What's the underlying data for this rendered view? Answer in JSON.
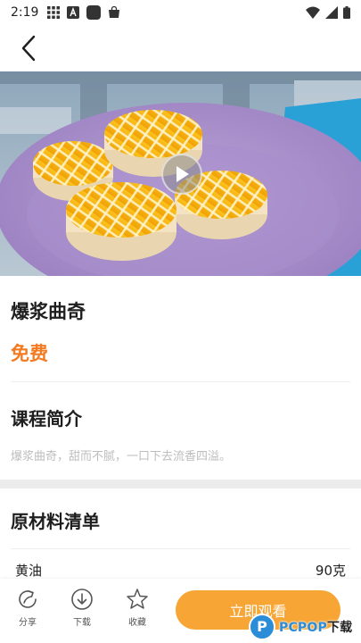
{
  "status_bar": {
    "time": "2:19",
    "left_icons": [
      "grid-icon",
      "a-badge-icon",
      "square-icon",
      "bag-icon"
    ],
    "right_icons": [
      "wifi-icon",
      "signal-icon",
      "battery-icon"
    ]
  },
  "nav": {
    "back_icon": "chevron-left-icon"
  },
  "hero": {
    "image_description": "tartlets-on-purple-plate",
    "colors": {
      "plate": "#a98fc8",
      "tart_top": "#f6b40e",
      "tart_base": "#f3e3c2",
      "background": "#9fb6c8"
    }
  },
  "course": {
    "title": "爆浆曲奇",
    "price": "免费"
  },
  "intro": {
    "heading": "课程简介",
    "text": "爆浆曲奇，甜而不腻，一口下去流香四溢。"
  },
  "materials": {
    "heading": "原材料清单",
    "items": [
      {
        "name": "黄油",
        "amount": "90克"
      }
    ]
  },
  "bottom_bar": {
    "share_label": "分享",
    "download_label": "下载",
    "favorite_label": "收藏",
    "watch_label": "立即观看",
    "accent_color": "#f7a534"
  },
  "watermark": {
    "brand": "PCPOP",
    "suffix": "下载",
    "logo_letter": "P"
  }
}
